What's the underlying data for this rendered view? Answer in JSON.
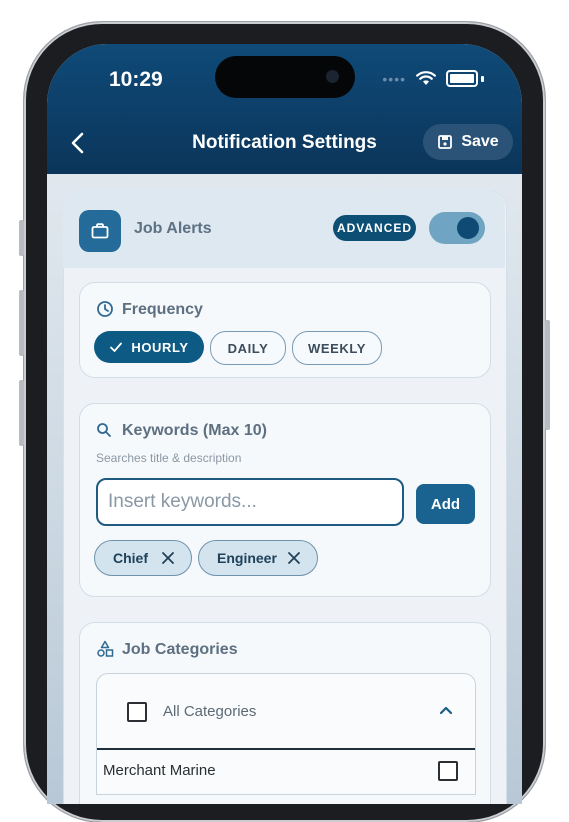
{
  "status_bar": {
    "time": "10:29",
    "signal_dots": "••••"
  },
  "header": {
    "title": "Notification Settings",
    "save_label": "Save"
  },
  "job_alerts": {
    "label": "Job Alerts",
    "badge": "ADVANCED",
    "toggle_on": true
  },
  "frequency": {
    "title": "Frequency",
    "options": [
      {
        "label": "HOURLY",
        "selected": true
      },
      {
        "label": "DAILY",
        "selected": false
      },
      {
        "label": "WEEKLY",
        "selected": false
      }
    ]
  },
  "keywords": {
    "title": "Keywords (Max 10)",
    "hint": "Searches title & description",
    "placeholder": "Insert keywords...",
    "add_label": "Add",
    "tags": [
      "Chief",
      "Engineer"
    ]
  },
  "categories": {
    "title": "Job Categories",
    "all_label": "All Categories",
    "items": [
      "Merchant Marine"
    ]
  },
  "colors": {
    "accent": "#0d5a85",
    "header_bg": "#0b355a",
    "toggle_track": "#6fa4c2"
  }
}
